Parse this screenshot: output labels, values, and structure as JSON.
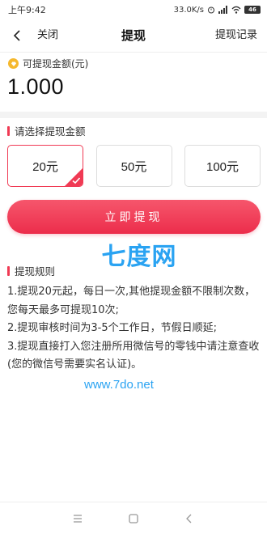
{
  "status_bar": {
    "time": "上午9:42",
    "speed": "33.0K/s",
    "battery": "46"
  },
  "nav": {
    "close_label": "关闭",
    "title": "提现",
    "record_label": "提现记录"
  },
  "balance": {
    "label": "可提现金额(元)",
    "value": "1.000"
  },
  "select_section": {
    "title": "请选择提现金额",
    "options": [
      "20元",
      "50元",
      "100元"
    ],
    "selected_index": 0
  },
  "withdraw_button": "立即提现",
  "rules": {
    "title": "提现规则",
    "items": [
      "1.提现20元起，每日一次,其他提现金额不限制次数，您每天最多可提现10次;",
      "2.提现审核时间为3-5个工作日，节假日顺延;",
      "3.提现直接打入您注册所用微信号的零钱中请注意查收(您的微信号需要实名认证)。"
    ]
  },
  "watermark": {
    "logo": "七度网",
    "url": "www.7do.net"
  },
  "colors": {
    "accent": "#f03a54",
    "watermark": "#2aa3f2",
    "coin": "#f5b82e"
  },
  "system_nav": {
    "icons": [
      "menu-icon",
      "home-icon",
      "back-icon"
    ]
  }
}
